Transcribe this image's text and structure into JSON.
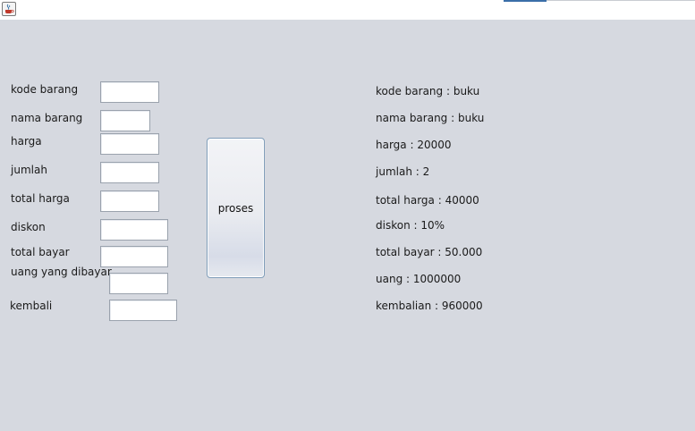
{
  "window": {
    "icon": "java-cup-icon"
  },
  "form": {
    "kode_barang_label": "kode barang",
    "nama_barang_label": "nama barang",
    "harga_label": "harga",
    "jumlah_label": "jumlah",
    "total_harga_label": "total harga",
    "diskon_label": "diskon",
    "total_bayar_label": "total bayar",
    "uang_dibayar_label": "uang yang dibayar",
    "kembali_label": "kembali",
    "kode_barang_value": "",
    "nama_barang_value": "",
    "harga_value": "",
    "jumlah_value": "",
    "total_harga_value": "",
    "diskon_value": "",
    "total_bayar_value": "",
    "uang_dibayar_value": "",
    "kembali_value": ""
  },
  "proses_button": "proses",
  "output": {
    "kode_barang": "kode barang : buku",
    "nama_barang": "nama barang : buku",
    "harga": "harga : 20000",
    "jumlah": "jumlah : 2",
    "total_harga": "total harga : 40000",
    "diskon": "diskon : 10%",
    "total_bayar": "total bayar : 50.000",
    "uang": "uang : 1000000",
    "kembalian": "kembalian : 960000"
  }
}
